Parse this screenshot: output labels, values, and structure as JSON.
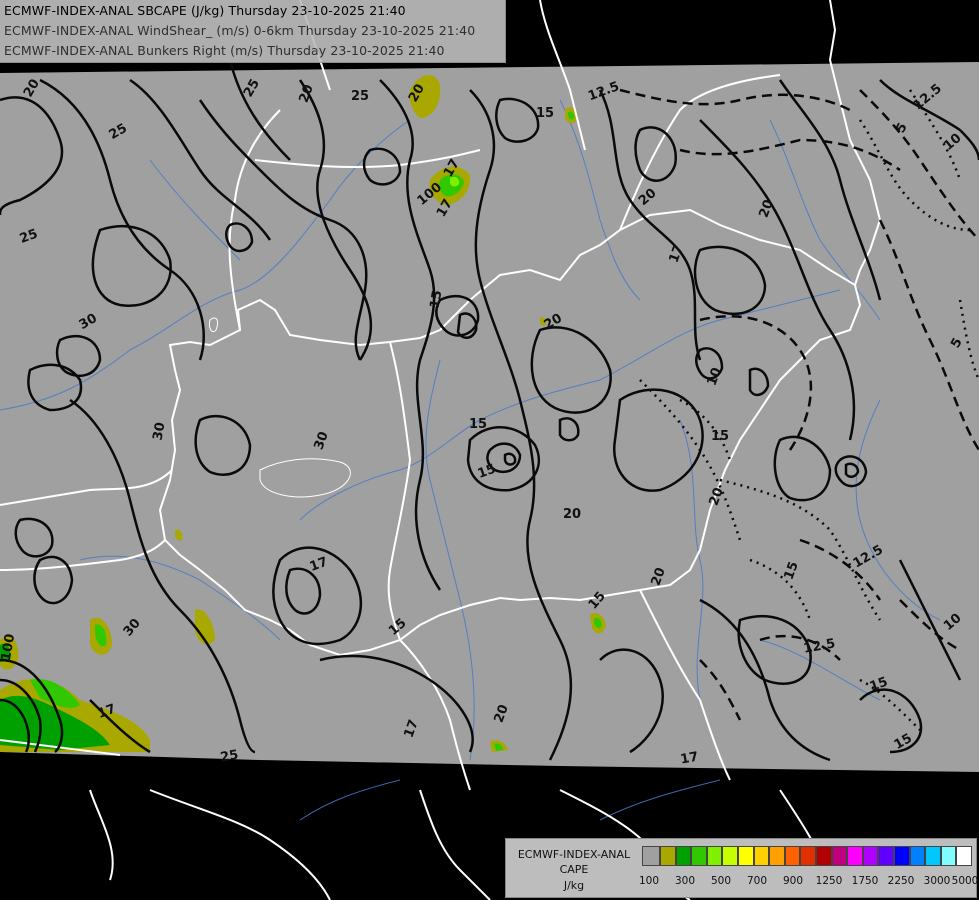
{
  "titles": [
    "ECMWF-INDEX-ANAL SBCAPE (J/kg) Thursday 23-10-2025 21:40",
    "ECMWF-INDEX-ANAL WindShear_ (m/s) 0-6km Thursday 23-10-2025 21:40",
    "ECMWF-INDEX-ANAL Bunkers Right (m/s) Thursday 23-10-2025 21:40"
  ],
  "legend": {
    "title_lines": [
      "ECMWF-INDEX-ANAL",
      "CAPE",
      "J/kg"
    ],
    "colors": [
      "#a0a0a0",
      "#a8a800",
      "#00a000",
      "#30c800",
      "#80f000",
      "#c8ff00",
      "#ffff00",
      "#ffd000",
      "#ffa000",
      "#ff6000",
      "#e03000",
      "#b00000",
      "#c00080",
      "#ff00ff",
      "#b000ff",
      "#6000ff",
      "#0000ff",
      "#0080ff",
      "#00c8ff",
      "#80ffff",
      "#ffffff"
    ],
    "tick_labels": [
      "100",
      "300",
      "500",
      "700",
      "900",
      "1250",
      "1750",
      "2250",
      "3000",
      "5000"
    ]
  },
  "contour_labels": [
    {
      "text": "20",
      "rot": -60
    },
    {
      "text": "25",
      "rot": -60
    },
    {
      "text": "20",
      "rot": -60
    },
    {
      "text": "25",
      "rot": 0
    },
    {
      "text": "25",
      "rot": -30
    },
    {
      "text": "20",
      "rot": -70
    },
    {
      "text": "15",
      "rot": 0
    },
    {
      "text": "12.5",
      "rot": -20
    },
    {
      "text": "12.5",
      "rot": -40
    },
    {
      "text": "5",
      "rot": -60
    },
    {
      "text": "10",
      "rot": -40
    },
    {
      "text": "25",
      "rot": -20
    },
    {
      "text": "100",
      "rot": -40
    },
    {
      "text": "17",
      "rot": -60
    },
    {
      "text": "17",
      "rot": -60
    },
    {
      "text": "20",
      "rot": -40
    },
    {
      "text": "20",
      "rot": -70
    },
    {
      "text": "17",
      "rot": -70
    },
    {
      "text": "15",
      "rot": -80
    },
    {
      "text": "20",
      "rot": -30
    },
    {
      "text": "30",
      "rot": -30
    },
    {
      "text": "30",
      "rot": -80
    },
    {
      "text": "30",
      "rot": -70
    },
    {
      "text": "15",
      "rot": 0
    },
    {
      "text": "15",
      "rot": -20
    },
    {
      "text": "20",
      "rot": 0
    },
    {
      "text": "10",
      "rot": -70
    },
    {
      "text": "15",
      "rot": 0
    },
    {
      "text": "5",
      "rot": -60
    },
    {
      "text": "17",
      "rot": -20
    },
    {
      "text": "15",
      "rot": -40
    },
    {
      "text": "20",
      "rot": -70
    },
    {
      "text": "15",
      "rot": -70
    },
    {
      "text": "12.5",
      "rot": -30
    },
    {
      "text": "15",
      "rot": -50
    },
    {
      "text": "12.5",
      "rot": -10
    },
    {
      "text": "15",
      "rot": -20
    },
    {
      "text": "10",
      "rot": -40
    },
    {
      "text": "15",
      "rot": -30
    },
    {
      "text": "30",
      "rot": -50
    },
    {
      "text": "100",
      "rot": -80
    },
    {
      "text": "17",
      "rot": -20
    },
    {
      "text": "25",
      "rot": -10
    },
    {
      "text": "20",
      "rot": -70
    },
    {
      "text": "17",
      "rot": -70
    },
    {
      "text": "17",
      "rot": -10
    },
    {
      "text": "20",
      "rot": -70
    }
  ]
}
